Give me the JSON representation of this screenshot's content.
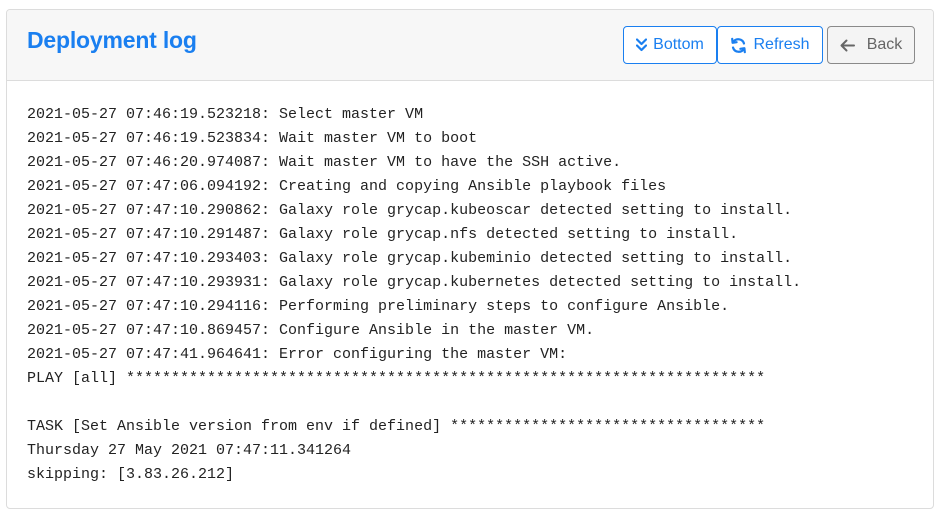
{
  "header": {
    "title": "Deployment log",
    "buttons": {
      "bottom": "Bottom",
      "refresh": "Refresh",
      "back": "Back"
    }
  },
  "colors": {
    "accent": "#1a7ff0",
    "header_bg": "#f7f7f7"
  },
  "icons": {
    "bottom": "double-chevron-down-icon",
    "refresh": "refresh-icon",
    "back": "arrow-left-icon"
  },
  "log_lines": [
    "2021-05-27 07:46:19.523218: Select master VM",
    "2021-05-27 07:46:19.523834: Wait master VM to boot",
    "2021-05-27 07:46:20.974087: Wait master VM to have the SSH active.",
    "2021-05-27 07:47:06.094192: Creating and copying Ansible playbook files",
    "2021-05-27 07:47:10.290862: Galaxy role grycap.kubeoscar detected setting to install.",
    "2021-05-27 07:47:10.291487: Galaxy role grycap.nfs detected setting to install.",
    "2021-05-27 07:47:10.293403: Galaxy role grycap.kubeminio detected setting to install.",
    "2021-05-27 07:47:10.293931: Galaxy role grycap.kubernetes detected setting to install.",
    "2021-05-27 07:47:10.294116: Performing preliminary steps to configure Ansible.",
    "2021-05-27 07:47:10.869457: Configure Ansible in the master VM.",
    "2021-05-27 07:47:41.964641: Error configuring the master VM:",
    "PLAY [all] ***********************************************************************",
    "",
    "TASK [Set Ansible version from env if defined] ***********************************",
    "Thursday 27 May 2021 07:47:11.341264",
    "skipping: [3.83.26.212]"
  ]
}
